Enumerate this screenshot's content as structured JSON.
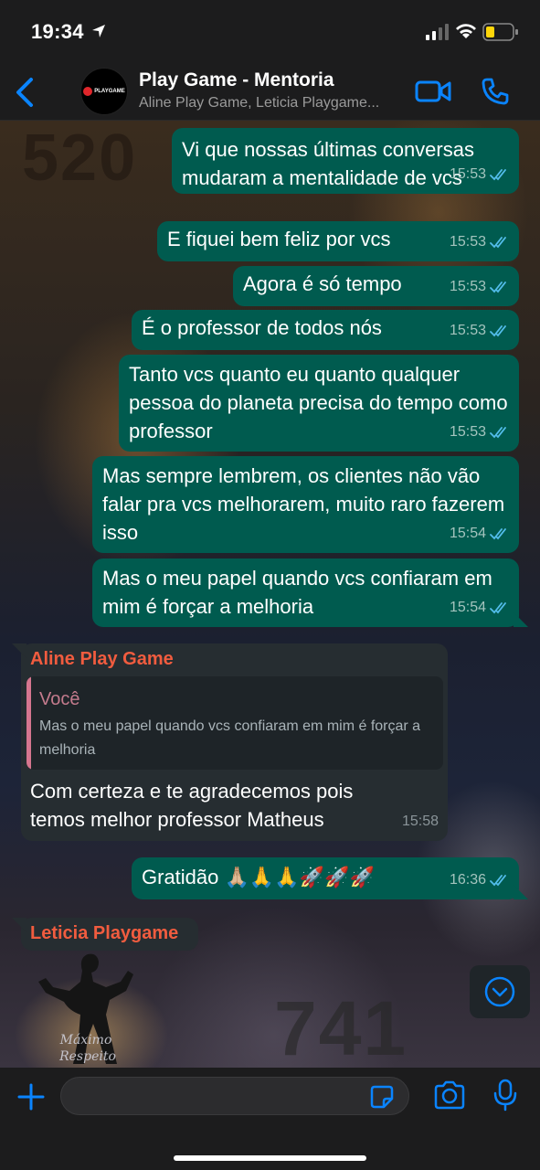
{
  "status_bar": {
    "time": "19:34"
  },
  "header": {
    "title": "Play Game - Mentoria",
    "subtitle": "Aline Play Game, Leticia Playgame...",
    "avatar_text": "PLAYGAME"
  },
  "wallpaper": {
    "number_top": "520",
    "number_bottom": "741"
  },
  "messages": [
    {
      "text": "Vi que nossas últimas conversas mudaram a mentalidade de vcs",
      "time": "15:53"
    },
    {
      "text": "E fiquei bem feliz por vcs",
      "time": "15:53"
    },
    {
      "text": "Agora é só tempo",
      "time": "15:53"
    },
    {
      "text": "É o professor de todos nós",
      "time": "15:53"
    },
    {
      "text": "Tanto vcs quanto eu quanto qualquer pessoa do planeta precisa do tempo como professor",
      "time": "15:53"
    },
    {
      "text": "Mas sempre lembrem, os clientes não vão falar pra vcs melhorarem, muito raro fazerem isso",
      "time": "15:54"
    },
    {
      "text": "Mas o meu papel quando vcs confiaram em mim é forçar a melhoria",
      "time": "15:54"
    }
  ],
  "reply": {
    "sender": "Aline Play Game",
    "quote_author": "Você",
    "quote_text": "Mas o meu papel quando vcs confiaram em mim é forçar a melhoria",
    "text": "Com certeza e te agradecemos pois temos melhor professor Matheus",
    "time": "15:58"
  },
  "gratitude": {
    "text": "Gratidão 🙏🏼🙏🙏🚀🚀🚀",
    "time": "16:36"
  },
  "sticker_message": {
    "sender": "Leticia Playgame",
    "sticker_text": "Máximo Respeito"
  },
  "colors": {
    "accent": "#0a84ff",
    "outgoing_bubble": "#005b4f",
    "incoming_bubble": "#262d31",
    "sender_name": "#f15c3f",
    "ticks": "#53bdeb"
  },
  "input": {
    "placeholder": "",
    "value": ""
  }
}
